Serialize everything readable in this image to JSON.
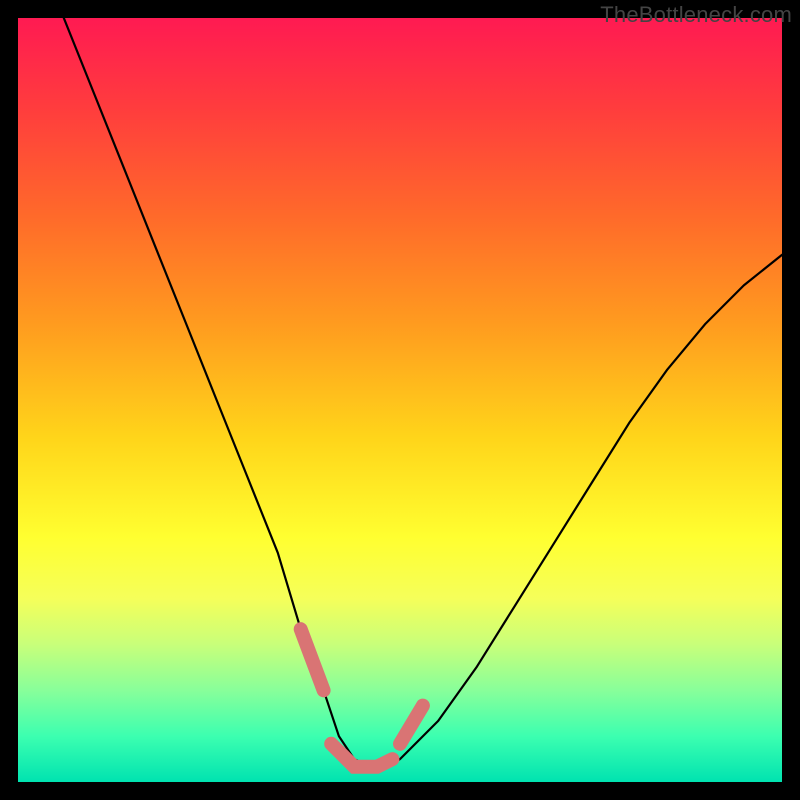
{
  "watermark": "TheBottleneck.com",
  "chart_data": {
    "type": "line",
    "title": "",
    "xlabel": "",
    "ylabel": "",
    "xlim": [
      0,
      100
    ],
    "ylim": [
      0,
      100
    ],
    "series": [
      {
        "name": "bottleneck-curve",
        "x": [
          6,
          10,
          14,
          18,
          22,
          26,
          30,
          34,
          37,
          40,
          42,
          44,
          46,
          48,
          50,
          55,
          60,
          65,
          70,
          75,
          80,
          85,
          90,
          95,
          100
        ],
        "values": [
          100,
          90,
          80,
          70,
          60,
          50,
          40,
          30,
          20,
          12,
          6,
          3,
          2,
          2,
          3,
          8,
          15,
          23,
          31,
          39,
          47,
          54,
          60,
          65,
          69
        ]
      }
    ],
    "markers": [
      {
        "name": "highlight-left",
        "x": [
          37,
          40
        ],
        "values": [
          20,
          12
        ]
      },
      {
        "name": "highlight-floor",
        "x": [
          41,
          44,
          47,
          49
        ],
        "values": [
          5,
          2,
          2,
          3
        ]
      },
      {
        "name": "highlight-right",
        "x": [
          50,
          53
        ],
        "values": [
          5,
          10
        ]
      }
    ],
    "gradient_stops": [
      {
        "pos": 0,
        "color": "#ff1a52"
      },
      {
        "pos": 55,
        "color": "#ffd51a"
      },
      {
        "pos": 100,
        "color": "#00e3b0"
      }
    ]
  }
}
